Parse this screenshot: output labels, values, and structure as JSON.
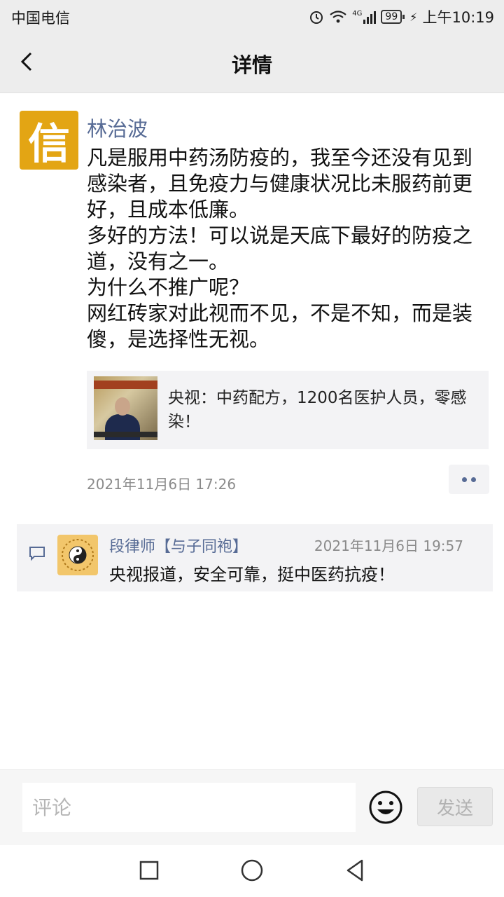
{
  "status_bar": {
    "carrier": "中国电信",
    "network": "4G",
    "battery": "99",
    "time": "上午10:19"
  },
  "nav": {
    "title": "详情",
    "back_icon": "chevron-left-icon"
  },
  "post": {
    "avatar_char": "信",
    "author": "林治波",
    "paragraphs": [
      "凡是服用中药汤防疫的，我至今还没有见到感染者，且免疫力与健康状况比未服药前更好，且成本低廉。",
      "多好的方法！可以说是天底下最好的防疫之道，没有之一。",
      "为什么不推广呢？",
      "网红砖家对此视而不见，不是不知，而是装傻，是选择性无视。"
    ],
    "link": {
      "title": "央视：中药配方，1200名医护人员，零感染！"
    },
    "time": "2021年11月6日 17:26"
  },
  "comments": [
    {
      "author": "段律师【与子同袍】",
      "time": "2021年11月6日 19:57",
      "text": "央视报道，安全可靠，挺中医药抗疫！"
    }
  ],
  "input_bar": {
    "placeholder": "评论",
    "send_label": "发送"
  },
  "colors": {
    "accent_link": "#576b95",
    "avatar_gold": "#e3a514",
    "bar_bg": "#ededed"
  }
}
